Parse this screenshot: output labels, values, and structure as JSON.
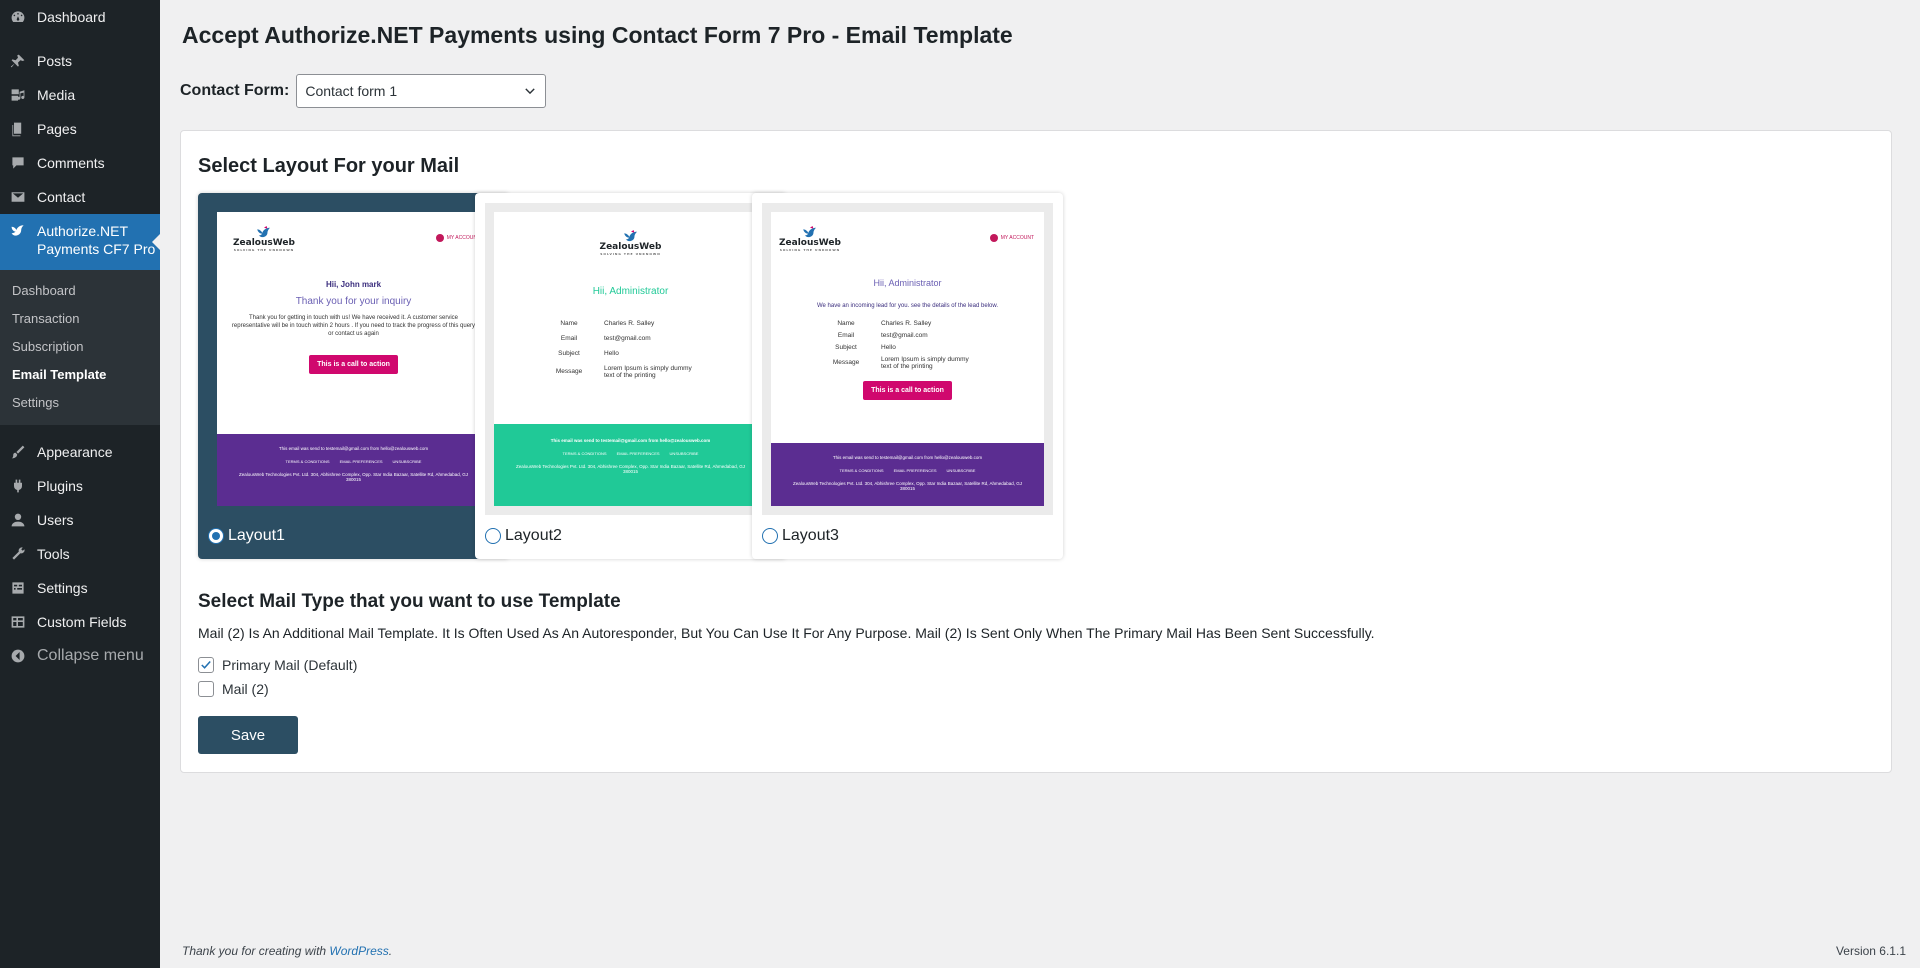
{
  "sidebar": {
    "top": [
      {
        "label": "Dashboard",
        "icon": "dashboard-icon"
      }
    ],
    "group1": [
      {
        "label": "Posts",
        "icon": "pin-icon"
      },
      {
        "label": "Media",
        "icon": "media-icon"
      },
      {
        "label": "Pages",
        "icon": "pages-icon"
      },
      {
        "label": "Comments",
        "icon": "comment-icon"
      },
      {
        "label": "Contact",
        "icon": "envelope-icon"
      }
    ],
    "current": {
      "label": "Authorize.NET Payments CF7 Pro",
      "icon": "bird-icon"
    },
    "submenu": [
      "Dashboard",
      "Transaction",
      "Subscription",
      "Email Template",
      "Settings"
    ],
    "group2": [
      {
        "label": "Appearance",
        "icon": "brush-icon"
      },
      {
        "label": "Plugins",
        "icon": "plugin-icon"
      },
      {
        "label": "Users",
        "icon": "user-icon"
      },
      {
        "label": "Tools",
        "icon": "wrench-icon"
      },
      {
        "label": "Settings",
        "icon": "settings-icon"
      },
      {
        "label": "Custom Fields",
        "icon": "table-icon"
      }
    ],
    "collapse": "Collapse menu"
  },
  "page": {
    "title": "Accept Authorize.NET Payments using Contact Form 7 Pro - Email Template",
    "contact_form_label": "Contact Form:",
    "contact_form_value": "Contact form 1"
  },
  "layouts": {
    "heading": "Select Layout For your Mail",
    "items": [
      {
        "label": "Layout1",
        "selected": true
      },
      {
        "label": "Layout2",
        "selected": false
      },
      {
        "label": "Layout3",
        "selected": false
      }
    ],
    "preview": {
      "logo": "ZealousWeb",
      "logo_tag": "SOLVING THE UNKNOWN",
      "my_account": "MY ACCOUNT",
      "l1_greeting": "Hii, John mark",
      "l1_subtitle": "Thank you for your inquiry",
      "l1_body": "Thank you for getting in touch with us! We have received it. A customer service representative will be in touch within 2 hours . If you need to track the progress of this query or contact us again",
      "cta": "This is a call to action",
      "admin_greeting": "Hii, Administrator",
      "l3_intro": "We have an incoming lead for you. see the details of the lead below.",
      "fields": [
        {
          "k": "Name",
          "v": "Charles R. Salley"
        },
        {
          "k": "Email",
          "v": "test@gmail.com"
        },
        {
          "k": "Subject",
          "v": "Hello"
        },
        {
          "k": "Message",
          "v": "Lorem Ipsum is simply dummy text of the printing"
        }
      ],
      "footer_sent": "This email was send to testemail@gmail.com from hello@zealousweb.com",
      "footer_links": [
        "TERMS & CONDITIONS",
        "EMAIL PREFERENCES",
        "UNSUBSCRIBE"
      ],
      "footer_address": "ZealousWeb Technologies Pvt. Ltd. 304, Abhishree Complex, Opp. Star India Bazaar, Satellite Rd, Ahmedabad, GJ 380015"
    },
    "colors": {
      "footer_purple": "#5b2d91",
      "footer_green": "#20c997",
      "selected_bg": "#2c4e63",
      "cta": "#d0086e"
    }
  },
  "mail_type": {
    "heading": "Select Mail Type that you want to use Template",
    "description": "Mail (2) Is An Additional Mail Template. It Is Often Used As An Autoresponder, But You Can Use It For Any Purpose. Mail (2) Is Sent Only When The Primary Mail Has Been Sent Successfully.",
    "primary_label": "Primary Mail (Default)",
    "primary_checked": true,
    "mail2_label": "Mail (2)",
    "mail2_checked": false,
    "save": "Save"
  },
  "footer": {
    "thanks_prefix": "Thank you for creating with ",
    "thanks_link": "WordPress",
    "thanks_suffix": ".",
    "version": "Version 6.1.1"
  }
}
